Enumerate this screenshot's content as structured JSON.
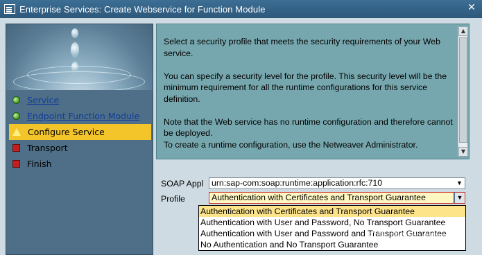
{
  "window": {
    "title": "Enterprise Services: Create Webservice for Function Module",
    "close_glyph": "✕"
  },
  "sidebar": {
    "steps": [
      {
        "label": "Service",
        "status": "complete",
        "link": true
      },
      {
        "label": "Endpoint Function Module",
        "status": "complete",
        "link": true
      },
      {
        "label": "Configure Service",
        "status": "current",
        "link": false
      },
      {
        "label": "Transport",
        "status": "pending",
        "link": false
      },
      {
        "label": "Finish",
        "status": "pending",
        "link": false
      }
    ]
  },
  "info": {
    "para1": "Select a security profile that meets the security requirements of your Web service.",
    "para2": "You can specify a security level for the profile. This security level will be the minimum requirement for all the runtime configurations for this service definition.",
    "para3_line1": "Note that the Web service has no runtime configuration and therefore cannot be deployed.",
    "para3_line2": "To create a runtime configuration, use the Netweaver Administrator."
  },
  "form": {
    "soap_label": "SOAP Appl",
    "soap_value": "urn:sap-com:soap:runtime:application:rfc:710",
    "profile_label": "Profile",
    "profile_value": "Authentication with Certificates and Transport Guarantee"
  },
  "profile_options": [
    "Authentication with Certificates and Transport Guarantee",
    "Authentication with User and Password, No Transport Guarantee",
    "Authentication with User and Password and Transport Guarantee",
    "No Authentication and No Transport Guarantee"
  ],
  "watermark": "知乎 @JerryWang",
  "colors": {
    "titlebar": "#2c587a",
    "current_step": "#f4c52a",
    "info_bg": "#77a7ae",
    "selected_option": "#fde38a"
  }
}
